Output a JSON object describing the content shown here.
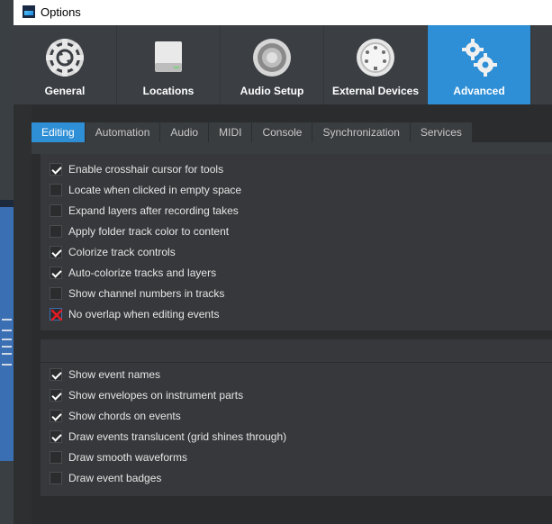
{
  "window": {
    "title": "Options"
  },
  "toolbar": {
    "items": [
      {
        "label": "General",
        "icon": "gear-icon"
      },
      {
        "label": "Locations",
        "icon": "drive-icon"
      },
      {
        "label": "Audio Setup",
        "icon": "speaker-icon"
      },
      {
        "label": "External Devices",
        "icon": "midi-port-icon"
      },
      {
        "label": "Advanced",
        "icon": "gears-icon",
        "active": true
      }
    ]
  },
  "tabs": [
    "Editing",
    "Automation",
    "Audio",
    "MIDI",
    "Console",
    "Synchronization",
    "Services"
  ],
  "active_tab": "Editing",
  "options_group1": [
    {
      "label": "Enable crosshair cursor for tools",
      "checked": true
    },
    {
      "label": "Locate when clicked in empty space",
      "checked": false
    },
    {
      "label": "Expand layers after recording takes",
      "checked": false
    },
    {
      "label": "Apply folder track color to content",
      "checked": false
    },
    {
      "label": "Colorize track controls",
      "checked": true
    },
    {
      "label": "Auto-colorize tracks and layers",
      "checked": true
    },
    {
      "label": "Show channel numbers in tracks",
      "checked": false
    },
    {
      "label": "No overlap when editing events",
      "checked": "cross"
    }
  ],
  "options_group2": [
    {
      "label": "Show event names",
      "checked": true
    },
    {
      "label": "Show envelopes on instrument parts",
      "checked": true
    },
    {
      "label": "Show chords on events",
      "checked": true
    },
    {
      "label": "Draw events translucent (grid shines through)",
      "checked": true
    },
    {
      "label": "Draw smooth waveforms",
      "checked": false
    },
    {
      "label": "Draw event badges",
      "checked": false
    }
  ],
  "colors": {
    "accent": "#2f8fd6",
    "background": "#2b2b2b",
    "toolbar": "#3b3f44"
  }
}
